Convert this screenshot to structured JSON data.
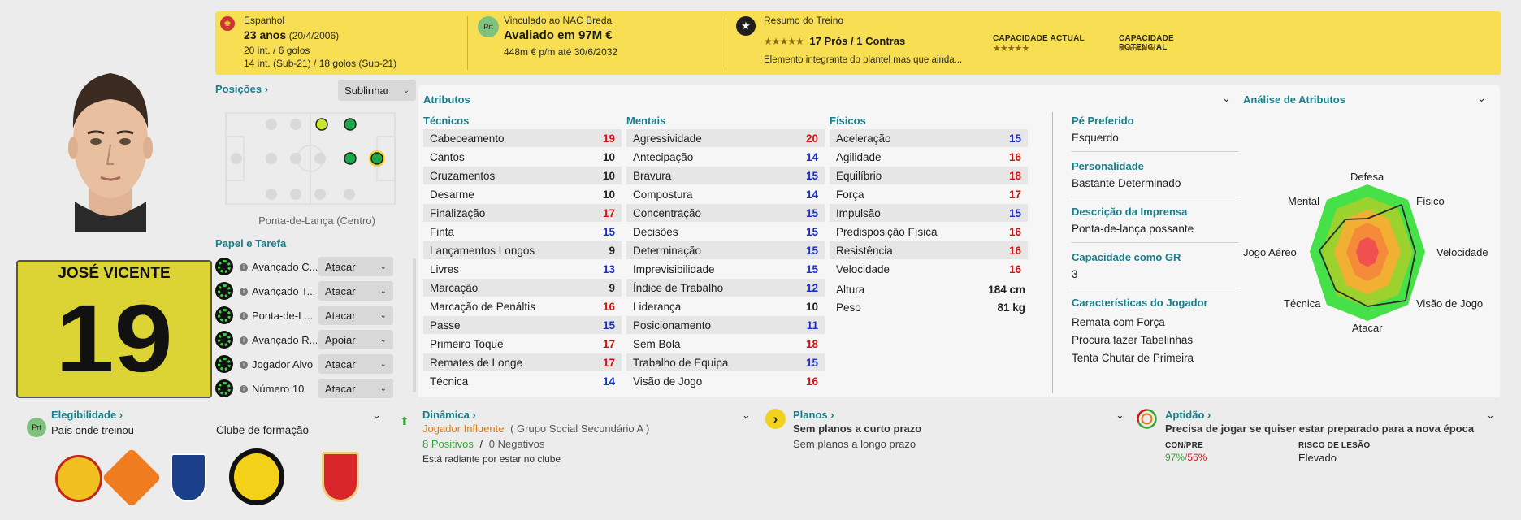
{
  "top": {
    "nationality": "Espanhol",
    "age": "23 anos",
    "dob": "(20/4/2006)",
    "caps": "20 int. / 6 golos",
    "caps_u21": "14 int. (Sub-21) / 18 golos (Sub-21)",
    "club_link": "Vinculado ao NAC Breda",
    "club_flag": "Prt",
    "value": "Avaliado em 97M €",
    "wage": "448m € p/m até 30/6/2032",
    "training_title": "Resumo do Treino",
    "training_stars": "★★★★★",
    "training_pros": "17 Prós / 1 Contras",
    "training_note": "Elemento integrante do plantel mas que ainda...",
    "current_ability_label": "CAPACIDADE ACTUAL",
    "potential_ability_label": "CAPACIDADE POTENCIAL",
    "ability_stars": "★★★★★"
  },
  "positions": {
    "label": "Posições",
    "sort_label": "Sublinhar",
    "position_caption": "Ponta-de-Lança (Centro)"
  },
  "player": {
    "name": "JOSÉ VICENTE",
    "number": "19"
  },
  "roles": {
    "title": "Papel e Tarefa",
    "items": [
      {
        "name": "Avançado C...",
        "duty": "Atacar"
      },
      {
        "name": "Avançado T...",
        "duty": "Atacar"
      },
      {
        "name": "Ponta-de-L...",
        "duty": "Atacar"
      },
      {
        "name": "Avançado R...",
        "duty": "Apoiar"
      },
      {
        "name": "Jogador Alvo",
        "duty": "Atacar"
      },
      {
        "name": "Número 10",
        "duty": "Atacar"
      }
    ]
  },
  "eligibility": {
    "label": "Elegibilidade",
    "flag": "Prt",
    "text": "País onde treinou",
    "youth_label": "Clube de formação"
  },
  "attributes": {
    "title": "Atributos",
    "technical_title": "Técnicos",
    "mental_title": "Mentais",
    "physical_title": "Físicos",
    "technical": [
      {
        "name": "Cabeceamento",
        "value": "19",
        "color": "red"
      },
      {
        "name": "Cantos",
        "value": "10",
        "color": "black"
      },
      {
        "name": "Cruzamentos",
        "value": "10",
        "color": "black"
      },
      {
        "name": "Desarme",
        "value": "10",
        "color": "black"
      },
      {
        "name": "Finalização",
        "value": "17",
        "color": "red"
      },
      {
        "name": "Finta",
        "value": "15",
        "color": "blue"
      },
      {
        "name": "Lançamentos Longos",
        "value": "9",
        "color": "black"
      },
      {
        "name": "Livres",
        "value": "13",
        "color": "blue"
      },
      {
        "name": "Marcação",
        "value": "9",
        "color": "black"
      },
      {
        "name": "Marcação de Penáltis",
        "value": "16",
        "color": "red"
      },
      {
        "name": "Passe",
        "value": "15",
        "color": "blue"
      },
      {
        "name": "Primeiro Toque",
        "value": "17",
        "color": "red"
      },
      {
        "name": "Remates de Longe",
        "value": "17",
        "color": "red"
      },
      {
        "name": "Técnica",
        "value": "14",
        "color": "blue"
      }
    ],
    "mental": [
      {
        "name": "Agressividade",
        "value": "20",
        "color": "red"
      },
      {
        "name": "Antecipação",
        "value": "14",
        "color": "blue"
      },
      {
        "name": "Bravura",
        "value": "15",
        "color": "blue"
      },
      {
        "name": "Compostura",
        "value": "14",
        "color": "blue"
      },
      {
        "name": "Concentração",
        "value": "15",
        "color": "blue"
      },
      {
        "name": "Decisões",
        "value": "15",
        "color": "blue"
      },
      {
        "name": "Determinação",
        "value": "15",
        "color": "blue"
      },
      {
        "name": "Imprevisibilidade",
        "value": "15",
        "color": "blue"
      },
      {
        "name": "Índice de Trabalho",
        "value": "12",
        "color": "blue"
      },
      {
        "name": "Liderança",
        "value": "10",
        "color": "black"
      },
      {
        "name": "Posicionamento",
        "value": "11",
        "color": "blue"
      },
      {
        "name": "Sem Bola",
        "value": "18",
        "color": "red"
      },
      {
        "name": "Trabalho de Equipa",
        "value": "15",
        "color": "blue"
      },
      {
        "name": "Visão de Jogo",
        "value": "16",
        "color": "red"
      }
    ],
    "physical": [
      {
        "name": "Aceleração",
        "value": "15",
        "color": "blue"
      },
      {
        "name": "Agilidade",
        "value": "16",
        "color": "red"
      },
      {
        "name": "Equilíbrio",
        "value": "18",
        "color": "red"
      },
      {
        "name": "Força",
        "value": "17",
        "color": "red"
      },
      {
        "name": "Impulsão",
        "value": "15",
        "color": "blue"
      },
      {
        "name": "Predisposição Física",
        "value": "16",
        "color": "red"
      },
      {
        "name": "Resistência",
        "value": "16",
        "color": "red"
      },
      {
        "name": "Velocidade",
        "value": "16",
        "color": "red"
      }
    ],
    "height_label": "Altura",
    "height": "184 cm",
    "weight_label": "Peso",
    "weight": "81 kg"
  },
  "info": {
    "foot_label": "Pé Preferido",
    "foot": "Esquerdo",
    "personality_label": "Personalidade",
    "personality": "Bastante Determinado",
    "media_label": "Descrição da Imprensa",
    "media": "Ponta-de-lança possante",
    "gk_label": "Capacidade como GR",
    "gk": "3",
    "traits_label": "Características do Jogador",
    "traits": [
      "Remata com Força",
      "Procura fazer Tabelinhas",
      "Tenta Chutar de Primeira"
    ]
  },
  "analysis": {
    "title": "Análise de Atributos",
    "axes": [
      "Defesa",
      "Físico",
      "Velocidade",
      "Visão de Jogo",
      "Atacar",
      "Técnica",
      "Jogo Aéreo",
      "Mental"
    ]
  },
  "dynamics": {
    "label": "Dinâmica",
    "status": "Jogador Influente",
    "group": "( Grupo Social Secundário A )",
    "positives": "8 Positivos",
    "slash": "/",
    "negatives": "0 Negativos",
    "note": "Está radiante por estar no clube"
  },
  "plans": {
    "label": "Planos",
    "short": "Sem planos a curto prazo",
    "long": "Sem planos a longo prazo"
  },
  "fitness": {
    "label": "Aptidão",
    "text": "Precisa de jogar se quiser estar preparado para a nova época",
    "con_label": "CON/PRE",
    "con_a": "97%",
    "con_b": "56%",
    "risk_label": "RISCO DE LESÃO",
    "risk": "Elevado"
  },
  "colors": {
    "accent": "#1b7e8c",
    "yellow": "#f8de52",
    "red": "#d31111",
    "blue": "#1a2fc9",
    "orange": "#e07a10",
    "green": "#3aa43a"
  }
}
